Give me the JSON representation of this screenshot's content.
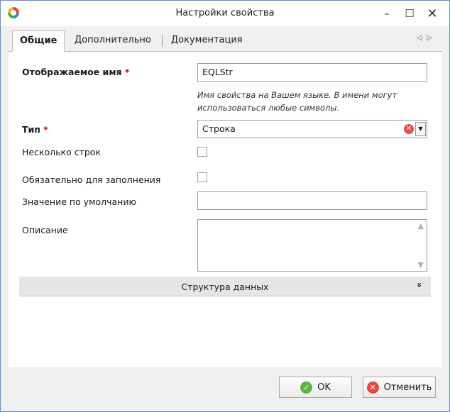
{
  "window": {
    "title": "Настройки свойства",
    "icon": "app-logo-icon",
    "minimize_glyph": "–",
    "maximize_glyph": "☐",
    "close_glyph": "✕"
  },
  "tabs": [
    {
      "label": "Общие",
      "active": true
    },
    {
      "label": "Дополнительно",
      "active": false
    },
    {
      "label": "Документация",
      "active": false
    }
  ],
  "tab_nav": {
    "prev_glyph": "◁",
    "next_glyph": "▷"
  },
  "form": {
    "display_name": {
      "label": "Отображаемое имя",
      "required_mark": "*",
      "value": "EQLStr"
    },
    "hint_line1": "Имя свойства на Вашем языке. В имени могут",
    "hint_line2": "использоваться любые символы.",
    "type": {
      "label": "Тип",
      "required_mark": "*",
      "value": "Строка",
      "clear_glyph": "✕",
      "dropdown_glyph": "▼"
    },
    "multiline": {
      "label": "Несколько строк",
      "checked": false
    },
    "mandatory": {
      "label": "Обязательно для заполнения",
      "checked": false
    },
    "default_value": {
      "label": "Значение по умолчанию",
      "value": ""
    },
    "description": {
      "label": "Описание",
      "value": ""
    },
    "scroll_up_glyph": "▲",
    "scroll_down_glyph": "▼"
  },
  "section": {
    "label": "Структура данных",
    "chevron_glyph": "»"
  },
  "buttons": {
    "ok": {
      "label": "OK",
      "icon_glyph": "✓"
    },
    "cancel": {
      "label": "Отменить",
      "icon_glyph": "✕"
    }
  },
  "colors": {
    "frame_border": "#6b8fbf",
    "required": "#d40000",
    "ok_icon": "#5fb341",
    "cancel_icon": "#e04a3f"
  }
}
